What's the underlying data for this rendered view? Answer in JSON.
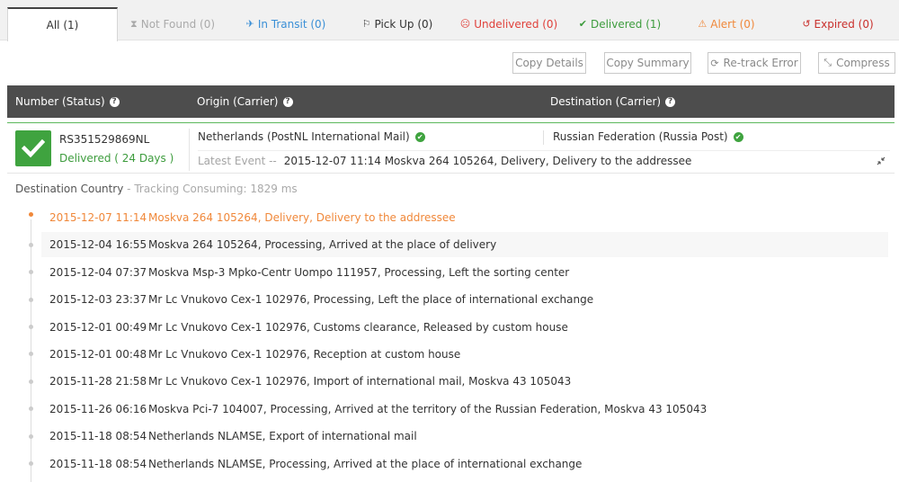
{
  "tabs": [
    {
      "label": "All (1)",
      "icon": "",
      "color": "#333333"
    },
    {
      "label": "Not Found (0)",
      "icon": "hourglass-icon",
      "color": "#aaaaaa"
    },
    {
      "label": "In Transit (0)",
      "icon": "plane-icon",
      "color": "#3a8fd6"
    },
    {
      "label": "Pick Up (0)",
      "icon": "flag-icon",
      "color": "#333333"
    },
    {
      "label": "Undelivered (0)",
      "icon": "sad-face-icon",
      "color": "#e0403a"
    },
    {
      "label": "Delivered (1)",
      "icon": "check-icon",
      "color": "#3d9c3d"
    },
    {
      "label": "Alert (0)",
      "icon": "warning-icon",
      "color": "#f0883a"
    },
    {
      "label": "Expired (0)",
      "icon": "history-icon",
      "color": "#c9302c"
    }
  ],
  "toolbar": {
    "copy_details": "Copy Details",
    "copy_summary": "Copy Summary",
    "retrack_error": "Re-track Error",
    "compress": "Compress"
  },
  "header": {
    "number": "Number (Status)",
    "origin": "Origin (Carrier)",
    "destination": "Destination (Carrier)"
  },
  "record": {
    "number": "RS351529869NL",
    "status": "Delivered ( 24 Days )",
    "origin": "Netherlands (PostNL International Mail)",
    "destination": "Russian Federation (Russia Post)",
    "latest_label": "Latest Event --",
    "latest_value": "2015-12-07 11:14 Moskva 264 105264, Delivery, Delivery to the addressee"
  },
  "destination_country": {
    "label": "Destination Country",
    "separator": " - ",
    "consuming": "Tracking Consuming: 1829 ms"
  },
  "events": [
    {
      "date": "2015-12-07 11:14",
      "desc": "Moskva 264 105264, Delivery, Delivery to the addressee"
    },
    {
      "date": "2015-12-04 16:55",
      "desc": "Moskva 264 105264, Processing, Arrived at the place of delivery"
    },
    {
      "date": "2015-12-04 07:37",
      "desc": "Moskva Msp-3 Mpko-Centr Uompo 111957, Processing, Left the sorting center"
    },
    {
      "date": "2015-12-03 23:37",
      "desc": "Mr Lc Vnukovo Cex-1 102976, Processing, Left the place of international exchange"
    },
    {
      "date": "2015-12-01 00:49",
      "desc": "Mr Lc Vnukovo Cex-1 102976, Customs clearance, Released by custom house"
    },
    {
      "date": "2015-12-01 00:48",
      "desc": "Mr Lc Vnukovo Cex-1 102976, Reception at custom house"
    },
    {
      "date": "2015-11-28 21:58",
      "desc": "Mr Lc Vnukovo Cex-1 102976, Import of international mail, Moskva 43 105043"
    },
    {
      "date": "2015-11-26 06:16",
      "desc": "Moskva Pci-7 104007, Processing, Arrived at the territory of the Russian Federation, Moskva 43 105043"
    },
    {
      "date": "2015-11-18 08:54",
      "desc": "Netherlands NLAMSE, Export of international mail"
    },
    {
      "date": "2015-11-18 08:54",
      "desc": "Netherlands NLAMSE, Processing, Arrived at the place of international exchange"
    }
  ]
}
